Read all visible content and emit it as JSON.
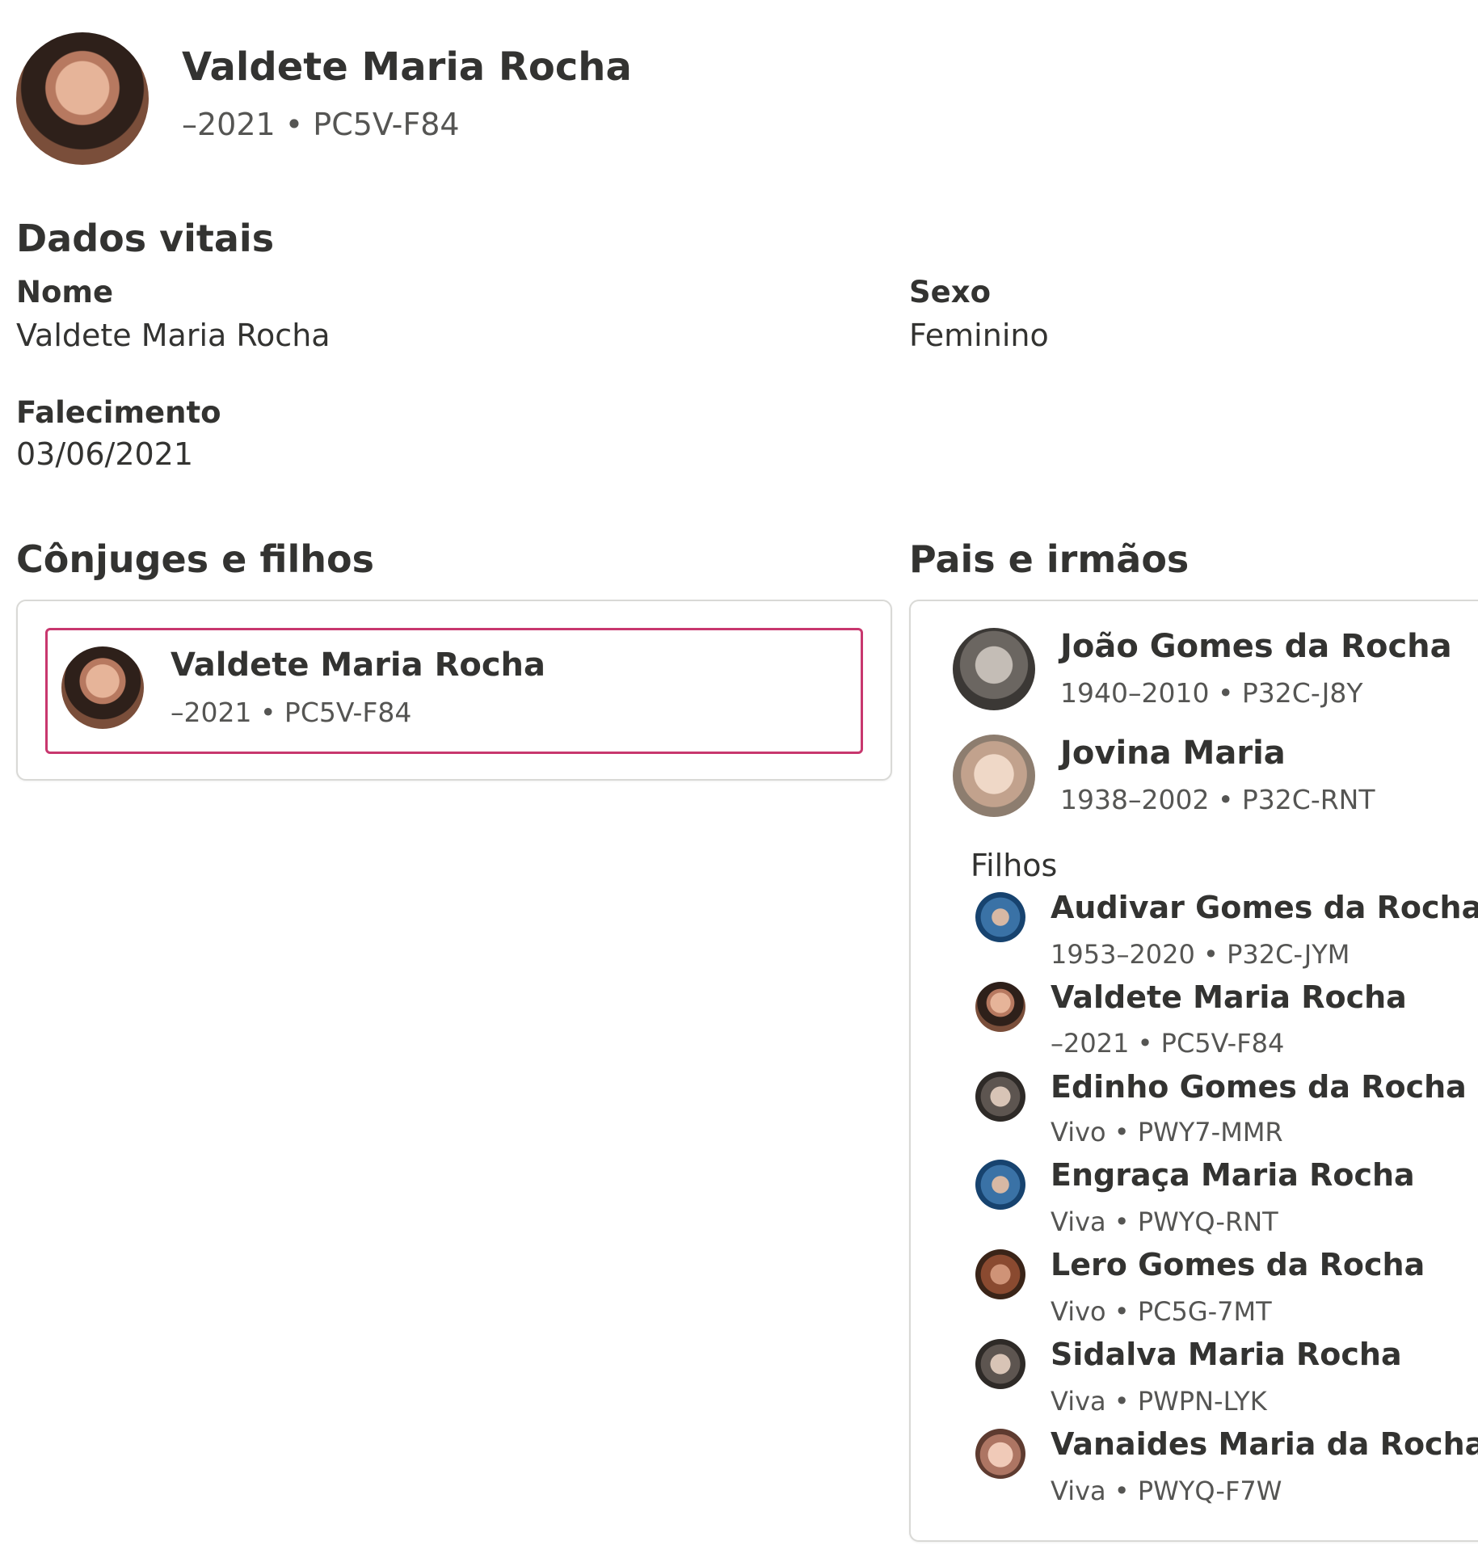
{
  "header": {
    "name": "Valdete Maria Rocha",
    "lifespan_id": "–2021 • PC5V-F84",
    "avatar_icon": "person-photo"
  },
  "vitals": {
    "title": "Dados vitais",
    "name_label": "Nome",
    "name_value": "Valdete Maria Rocha",
    "sex_label": "Sexo",
    "sex_value": "Feminino",
    "death_label": "Falecimento",
    "death_value": "03/06/2021"
  },
  "spouses": {
    "title": "Cônjuges e filhos",
    "selected": {
      "name": "Valdete Maria Rocha",
      "lifespan_id": "–2021 • PC5V-F84"
    },
    "accent_color": "#c8376e"
  },
  "parents": {
    "title": "Pais e irmãos",
    "items": [
      {
        "name": "João Gomes da Rocha",
        "lifespan_id": "1940–2010 • P32C-J8Y"
      },
      {
        "name": "Jovina Maria",
        "lifespan_id": "1938–2002 • P32C-RNT"
      }
    ],
    "children_label": "Filhos",
    "children": [
      {
        "name": "Audivar Gomes da Rocha",
        "lifespan_id": "1953–2020 • P32C-JYM"
      },
      {
        "name": "Valdete Maria Rocha",
        "lifespan_id": "–2021 • PC5V-F84"
      },
      {
        "name": "Edinho Gomes da Rocha",
        "lifespan_id": "Vivo • PWY7-MMR"
      },
      {
        "name": "Engraça Maria Rocha",
        "lifespan_id": "Viva • PWYQ-RNT"
      },
      {
        "name": "Lero Gomes da Rocha",
        "lifespan_id": "Vivo • PC5G-7MT"
      },
      {
        "name": "Sidalva Maria Rocha",
        "lifespan_id": "Viva • PWPN-LYK"
      },
      {
        "name": "Vanaides Maria da Rocha",
        "lifespan_id": "Viva • PWYQ-F7W"
      }
    ]
  }
}
